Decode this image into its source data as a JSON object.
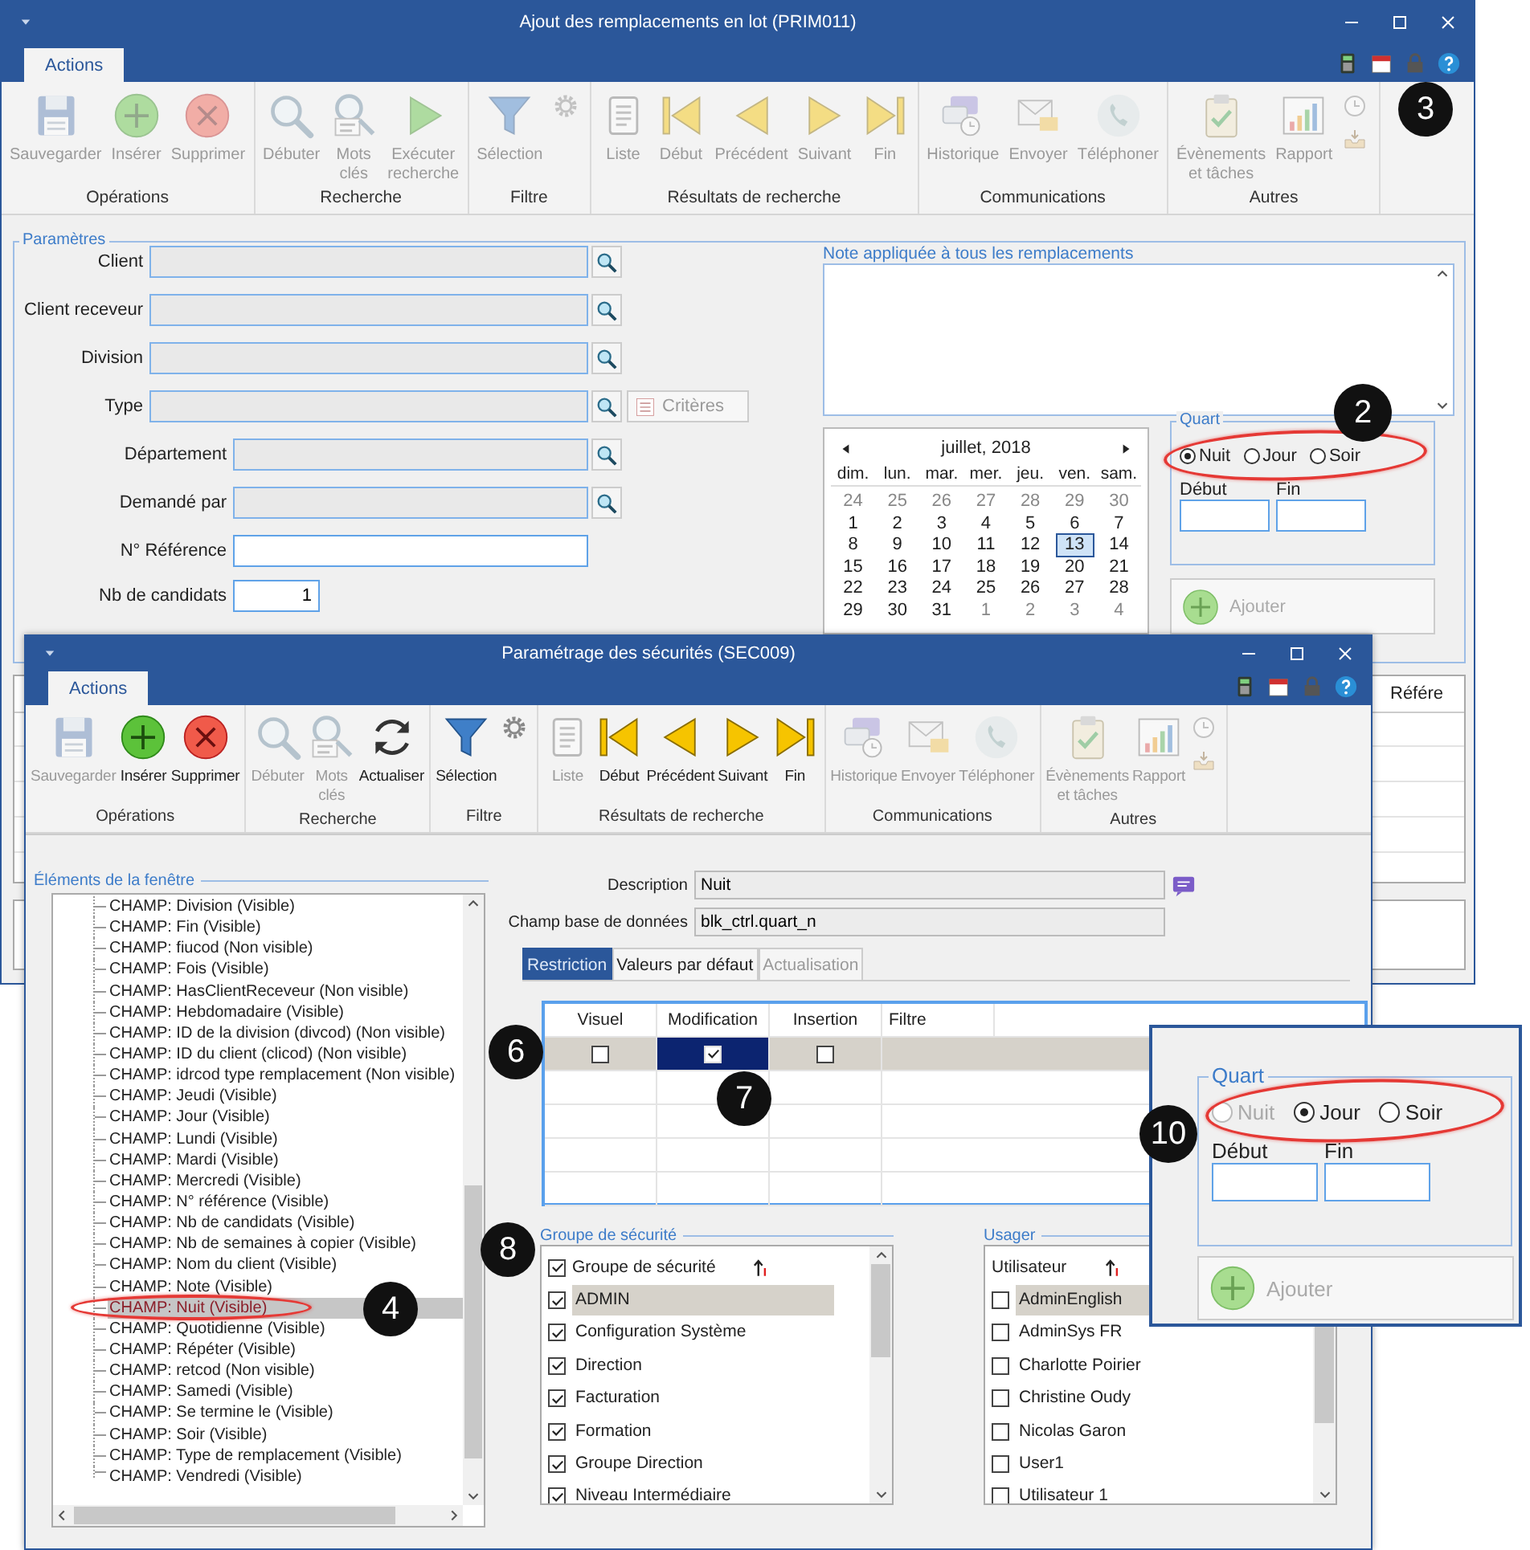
{
  "main_window": {
    "title": "Ajout des remplacements en lot (PRIM011)",
    "tabs": [
      {
        "label": "Actions",
        "selected": true
      }
    ],
    "ribbon": {
      "callout": "3",
      "groups": [
        {
          "label": "Opérations",
          "buttons": [
            {
              "label": "Sauvegarder",
              "kind": "save",
              "disabled": true
            },
            {
              "label": "Insérer",
              "kind": "insert",
              "disabled": true
            },
            {
              "label": "Supprimer",
              "kind": "delete",
              "disabled": true
            }
          ]
        },
        {
          "label": "Recherche",
          "buttons": [
            {
              "label": "Débuter",
              "kind": "start",
              "disabled": true
            },
            {
              "label": "Mots\nclés",
              "kind": "keywords",
              "disabled": true
            },
            {
              "label": "Exécuter\nrecherche",
              "kind": "run",
              "disabled": true
            }
          ]
        },
        {
          "label": "Filtre",
          "buttons": [
            {
              "label": "Sélection",
              "kind": "filter",
              "disabled": true
            }
          ],
          "extras": [
            {
              "kind": "settings",
              "disabled": true
            }
          ]
        },
        {
          "label": "Résultats de recherche",
          "buttons": [
            {
              "label": "Liste",
              "kind": "list",
              "disabled": true
            },
            {
              "label": "Début",
              "kind": "first",
              "disabled": true
            },
            {
              "label": "Précédent",
              "kind": "previous",
              "disabled": true
            },
            {
              "label": "Suivant",
              "kind": "next",
              "disabled": true
            },
            {
              "label": "Fin",
              "kind": "last",
              "disabled": true
            }
          ]
        },
        {
          "label": "Communications",
          "buttons": [
            {
              "label": "Historique",
              "kind": "history",
              "disabled": true
            },
            {
              "label": "Envoyer",
              "kind": "send",
              "disabled": true
            },
            {
              "label": "Téléphoner",
              "kind": "call",
              "disabled": true
            }
          ]
        },
        {
          "label": "Autres",
          "buttons": [
            {
              "label": "Évènements\net tâches",
              "kind": "events",
              "disabled": true
            },
            {
              "label": "Rapport",
              "kind": "report",
              "disabled": true
            }
          ],
          "extras": [
            {
              "kind": "recent",
              "disabled": true
            },
            {
              "kind": "inbox",
              "disabled": true
            }
          ]
        }
      ]
    },
    "parameters": {
      "title": "Paramètres",
      "fields": [
        {
          "kind": "lookup",
          "label": "Client",
          "disabled": true
        },
        {
          "kind": "lookup",
          "label": "Client receveur",
          "disabled": true
        },
        {
          "kind": "lookup",
          "label": "Division",
          "disabled": true
        },
        {
          "kind": "lookup",
          "label": "Type",
          "disabled": true,
          "button": {
            "label": "Critères",
            "disabled": true
          }
        },
        {
          "kind": "sublookup",
          "label": "Département",
          "disabled": true
        },
        {
          "kind": "sublookup",
          "label": "Demandé par",
          "disabled": true
        },
        {
          "kind": "text",
          "label": "N° Référence",
          "disabled": false
        },
        {
          "kind": "number",
          "label": "Nb de candidats",
          "value": "1",
          "disabled": false
        }
      ]
    },
    "note": {
      "title": "Note appliquée à tous les remplacements"
    },
    "calendar": {
      "month": "juillet, 2018",
      "weekdays": [
        "dim.",
        "lun.",
        "mar.",
        "mer.",
        "jeu.",
        "ven.",
        "sam."
      ],
      "weeks": [
        [
          {
            "day": "24",
            "other_month": true,
            "selected": false
          },
          {
            "day": "25",
            "other_month": true,
            "selected": false
          },
          {
            "day": "26",
            "other_month": true,
            "selected": false
          },
          {
            "day": "27",
            "other_month": true,
            "selected": false
          },
          {
            "day": "28",
            "other_month": true,
            "selected": false
          },
          {
            "day": "29",
            "other_month": true,
            "selected": false
          },
          {
            "day": "30",
            "other_month": true,
            "selected": false
          }
        ],
        [
          {
            "day": "1",
            "other_month": false,
            "selected": false
          },
          {
            "day": "2",
            "other_month": false,
            "selected": false
          },
          {
            "day": "3",
            "other_month": false,
            "selected": false
          },
          {
            "day": "4",
            "other_month": false,
            "selected": false
          },
          {
            "day": "5",
            "other_month": false,
            "selected": false
          },
          {
            "day": "6",
            "other_month": false,
            "selected": false
          },
          {
            "day": "7",
            "other_month": false,
            "selected": false
          }
        ],
        [
          {
            "day": "8",
            "other_month": false,
            "selected": false
          },
          {
            "day": "9",
            "other_month": false,
            "selected": false
          },
          {
            "day": "10",
            "other_month": false,
            "selected": false
          },
          {
            "day": "11",
            "other_month": false,
            "selected": false
          },
          {
            "day": "12",
            "other_month": false,
            "selected": false
          },
          {
            "day": "13",
            "other_month": false,
            "selected": true
          },
          {
            "day": "14",
            "other_month": false,
            "selected": false
          }
        ],
        [
          {
            "day": "15",
            "other_month": false,
            "selected": false
          },
          {
            "day": "16",
            "other_month": false,
            "selected": false
          },
          {
            "day": "17",
            "other_month": false,
            "selected": false
          },
          {
            "day": "18",
            "other_month": false,
            "selected": false
          },
          {
            "day": "19",
            "other_month": false,
            "selected": false
          },
          {
            "day": "20",
            "other_month": false,
            "selected": false
          },
          {
            "day": "21",
            "other_month": false,
            "selected": false
          }
        ],
        [
          {
            "day": "22",
            "other_month": false,
            "selected": false
          },
          {
            "day": "23",
            "other_month": false,
            "selected": false
          },
          {
            "day": "24",
            "other_month": false,
            "selected": false
          },
          {
            "day": "25",
            "other_month": false,
            "selected": false
          },
          {
            "day": "26",
            "other_month": false,
            "selected": false
          },
          {
            "day": "27",
            "other_month": false,
            "selected": false
          },
          {
            "day": "28",
            "other_month": false,
            "selected": false
          }
        ],
        [
          {
            "day": "29",
            "other_month": false,
            "selected": false
          },
          {
            "day": "30",
            "other_month": false,
            "selected": false
          },
          {
            "day": "31",
            "other_month": false,
            "selected": false
          },
          {
            "day": "1",
            "other_month": true,
            "selected": false
          },
          {
            "day": "2",
            "other_month": true,
            "selected": false
          },
          {
            "day": "3",
            "other_month": true,
            "selected": false
          },
          {
            "day": "4",
            "other_month": true,
            "selected": false
          }
        ]
      ]
    },
    "quart": {
      "title": "Quart",
      "circled": true,
      "callout": "2",
      "options": [
        {
          "label": "Nuit",
          "selected": true,
          "disabled": false
        },
        {
          "label": "Jour",
          "selected": false,
          "disabled": false
        },
        {
          "label": "Soir",
          "selected": false,
          "disabled": false
        }
      ],
      "start_label": "Début",
      "end_label": "Fin"
    },
    "add_button": {
      "label": "Ajouter",
      "disabled": true
    },
    "results_grid": {
      "columns": [
        "Référe"
      ]
    }
  },
  "security_window": {
    "title": "Paramétrage des sécurités (SEC009)",
    "tabs": [
      {
        "label": "Actions",
        "selected": true
      }
    ],
    "ribbon": {
      "groups": [
        {
          "label": "Opérations",
          "buttons": [
            {
              "label": "Sauvegarder",
              "kind": "save",
              "disabled": true
            },
            {
              "label": "Insérer",
              "kind": "insert",
              "disabled": false
            },
            {
              "label": "Supprimer",
              "kind": "delete",
              "disabled": false
            }
          ]
        },
        {
          "label": "Recherche",
          "buttons": [
            {
              "label": "Débuter",
              "kind": "start",
              "disabled": true
            },
            {
              "label": "Mots\nclés",
              "kind": "keywords",
              "disabled": true
            },
            {
              "label": "Actualiser",
              "kind": "refresh",
              "disabled": false
            }
          ]
        },
        {
          "label": "Filtre",
          "buttons": [
            {
              "label": "Sélection",
              "kind": "filter",
              "disabled": false
            }
          ],
          "extras": [
            {
              "kind": "settings",
              "disabled": false
            }
          ]
        },
        {
          "label": "Résultats de recherche",
          "buttons": [
            {
              "label": "Liste",
              "kind": "list",
              "disabled": true
            },
            {
              "label": "Début",
              "kind": "first",
              "disabled": false
            },
            {
              "label": "Précédent",
              "kind": "previous",
              "disabled": false
            },
            {
              "label": "Suivant",
              "kind": "next",
              "disabled": false
            },
            {
              "label": "Fin",
              "kind": "last",
              "disabled": false
            }
          ]
        },
        {
          "label": "Communications",
          "buttons": [
            {
              "label": "Historique",
              "kind": "history",
              "disabled": true
            },
            {
              "label": "Envoyer",
              "kind": "send",
              "disabled": true
            },
            {
              "label": "Téléphoner",
              "kind": "call",
              "disabled": true
            }
          ]
        },
        {
          "label": "Autres",
          "buttons": [
            {
              "label": "Évènements\net tâches",
              "kind": "events",
              "disabled": true
            },
            {
              "label": "Rapport",
              "kind": "report",
              "disabled": true
            }
          ],
          "extras": [
            {
              "kind": "recent",
              "disabled": true
            },
            {
              "kind": "inbox",
              "disabled": true
            }
          ]
        }
      ]
    },
    "elements": {
      "title": "Éléments de la fenêtre",
      "items": [
        {
          "label": "CHAMP: Division (Visible)",
          "selected": false
        },
        {
          "label": "CHAMP: Fin (Visible)",
          "selected": false
        },
        {
          "label": "CHAMP: fiucod (Non visible)",
          "selected": false
        },
        {
          "label": "CHAMP: Fois (Visible)",
          "selected": false
        },
        {
          "label": "CHAMP: HasClientReceveur (Non visible)",
          "selected": false
        },
        {
          "label": "CHAMP: Hebdomadaire (Visible)",
          "selected": false
        },
        {
          "label": "CHAMP: ID de la division (divcod) (Non visible)",
          "selected": false
        },
        {
          "label": "CHAMP: ID du client (clicod) (Non visible)",
          "selected": false
        },
        {
          "label": "CHAMP: idrcod type remplacement (Non visible)",
          "selected": false
        },
        {
          "label": "CHAMP: Jeudi (Visible)",
          "selected": false
        },
        {
          "label": "CHAMP: Jour (Visible)",
          "selected": false
        },
        {
          "label": "CHAMP: Lundi (Visible)",
          "selected": false
        },
        {
          "label": "CHAMP: Mardi (Visible)",
          "selected": false
        },
        {
          "label": "CHAMP: Mercredi (Visible)",
          "selected": false
        },
        {
          "label": "CHAMP: N° référence (Visible)",
          "selected": false
        },
        {
          "label": "CHAMP: Nb de candidats (Visible)",
          "selected": false
        },
        {
          "label": "CHAMP: Nb de semaines à copier (Visible)",
          "selected": false
        },
        {
          "label": "CHAMP: Nom du client (Visible)",
          "selected": false
        },
        {
          "label": "CHAMP: Note (Visible)",
          "selected": false
        },
        {
          "label": "CHAMP: Nuit (Visible)",
          "selected": true,
          "circled": true,
          "callout": "4"
        },
        {
          "label": "CHAMP: Quotidienne (Visible)",
          "selected": false
        },
        {
          "label": "CHAMP: Répéter (Visible)",
          "selected": false
        },
        {
          "label": "CHAMP: retcod (Non visible)",
          "selected": false
        },
        {
          "label": "CHAMP: Samedi (Visible)",
          "selected": false
        },
        {
          "label": "CHAMP: Se termine le (Visible)",
          "selected": false
        },
        {
          "label": "CHAMP: Soir (Visible)",
          "selected": false
        },
        {
          "label": "CHAMP: Type de remplacement (Visible)",
          "selected": false
        },
        {
          "label": "CHAMP: Vendredi (Visible)",
          "selected": false
        }
      ]
    },
    "description": {
      "label": "Description",
      "value": "Nuit"
    },
    "db_field": {
      "label": "Champ base de données",
      "value": "blk_ctrl.quart_n"
    },
    "detail_tabs": [
      {
        "label": "Restriction",
        "selected": true,
        "disabled": false
      },
      {
        "label": "Valeurs par défaut",
        "selected": false,
        "disabled": false
      },
      {
        "label": "Actualisation",
        "selected": false,
        "disabled": true
      }
    ],
    "restrictions": {
      "columns": [
        "Visuel",
        "Modification",
        "Insertion",
        "Filtre"
      ],
      "rows": [
        {
          "selected": true,
          "callout": "6",
          "cells": [
            {
              "checked": false,
              "selected": false
            },
            {
              "checked": true,
              "selected": true,
              "callout": "7"
            },
            {
              "checked": false,
              "selected": false
            }
          ]
        }
      ]
    },
    "security_groups": {
      "title": "Groupe de sécurité",
      "callout": "8",
      "header": {
        "label": "Groupe de sécurité",
        "checked": true
      },
      "items": [
        {
          "label": "ADMIN",
          "checked": true,
          "selected": true
        },
        {
          "label": "Configuration Système",
          "checked": true,
          "selected": false
        },
        {
          "label": "Direction",
          "checked": true,
          "selected": false
        },
        {
          "label": "Facturation",
          "checked": true,
          "selected": false
        },
        {
          "label": "Formation",
          "checked": true,
          "selected": false
        },
        {
          "label": "Groupe Direction",
          "checked": true,
          "selected": false
        },
        {
          "label": "Niveau Intermédiaire",
          "checked": true,
          "selected": false
        }
      ]
    },
    "users": {
      "title": "Usager",
      "header": {
        "label": "Utilisateur"
      },
      "items": [
        {
          "label": "AdminEnglish",
          "checked": false,
          "selected": true
        },
        {
          "label": "AdminSys FR",
          "checked": false,
          "selected": false
        },
        {
          "label": "Charlotte Poirier",
          "checked": false,
          "selected": false
        },
        {
          "label": "Christine Oudy",
          "checked": false,
          "selected": false
        },
        {
          "label": "Nicolas Garon",
          "checked": false,
          "selected": false
        },
        {
          "label": "User1",
          "checked": false,
          "selected": false
        },
        {
          "label": "Utilisateur 1",
          "checked": false,
          "selected": false
        }
      ]
    }
  },
  "quart_popup": {
    "title": "Quart",
    "circled": true,
    "callout": "10",
    "options": [
      {
        "label": "Nuit",
        "selected": false,
        "disabled": true
      },
      {
        "label": "Jour",
        "selected": true,
        "disabled": false
      },
      {
        "label": "Soir",
        "selected": false,
        "disabled": false
      }
    ],
    "start_label": "Début",
    "end_label": "Fin",
    "add_button": {
      "label": "Ajouter",
      "disabled": true
    }
  }
}
